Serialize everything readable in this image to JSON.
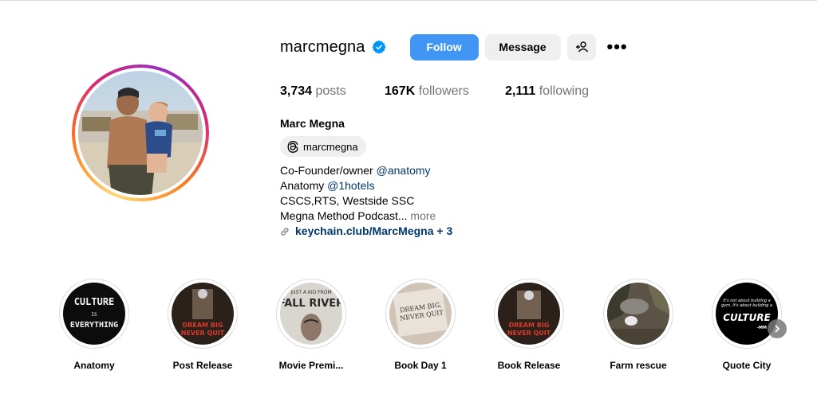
{
  "profile": {
    "username": "marcmegna",
    "verified": true,
    "full_name": "Marc Megna",
    "threads_handle": "marcmegna",
    "avatar_icon": "profile-photo-man-holding-child"
  },
  "actions": {
    "follow_label": "Follow",
    "message_label": "Message",
    "suggest_icon": "add-person-icon",
    "more_icon": "more-options-icon",
    "more_glyph": "•••"
  },
  "stats": {
    "posts_count": "3,734",
    "posts_label": "posts",
    "followers_count": "167K",
    "followers_label": "followers",
    "following_count": "2,111",
    "following_label": "following"
  },
  "bio": {
    "line1_text": "Co-Founder/owner ",
    "line1_mention": "@anatomy",
    "line2_text": "Anatomy ",
    "line2_mention": "@1hotels",
    "line3": "CSCS,RTS, Westside SSC",
    "line4": "Megna Method Podcast...",
    "more_label": " more",
    "link_text": "keychain.club/MarcMegna + 3"
  },
  "highlights": [
    {
      "label": "Anatomy",
      "cover_text_top": "CULTURE",
      "cover_text_mid": "IS",
      "cover_text_bot": "EVERYTHING"
    },
    {
      "label": "Post Release",
      "cover_text_top": "DREAM BIG",
      "cover_text_bot": "NEVER QUIT"
    },
    {
      "label": "Movie Premi...",
      "cover_text_top": "JUST A KID FROM",
      "cover_text_bot": "FALL RIVER"
    },
    {
      "label": "Book Day 1",
      "cover_text_top": "DREAM BIG,",
      "cover_text_bot": "NEVER QUIT"
    },
    {
      "label": "Book Release",
      "cover_text_top": "DREAM BIG",
      "cover_text_bot": "NEVER QUIT"
    },
    {
      "label": "Farm rescue"
    },
    {
      "label": "Quote City",
      "cover_text_top": "It's not about building a gym. It's about building a",
      "cover_text_mid": "CULTURE",
      "cover_text_bot": "-MM"
    }
  ],
  "colors": {
    "follow_blue": "#4196f4",
    "link_blue": "#00376b",
    "verified_blue": "#0095f6"
  }
}
